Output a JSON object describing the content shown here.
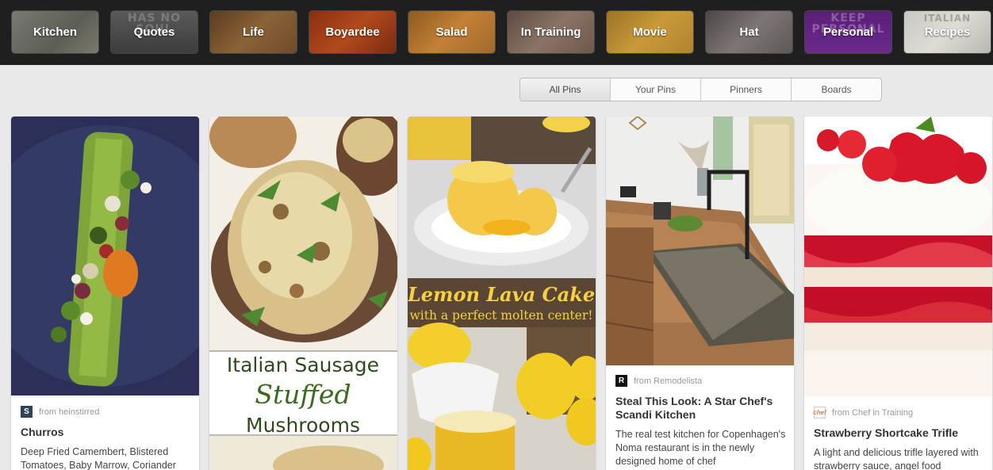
{
  "boards": [
    {
      "label": "Kitchen",
      "bg": "Kitchen"
    },
    {
      "label": "Quotes",
      "bg": "HAS NO SOUL"
    },
    {
      "label": "Life",
      "bg": ""
    },
    {
      "label": "Boyardee",
      "bg": ""
    },
    {
      "label": "Salad",
      "bg": ""
    },
    {
      "label": "In Training",
      "bg": ""
    },
    {
      "label": "Movie",
      "bg": ""
    },
    {
      "label": "Hat",
      "bg": ""
    },
    {
      "label": "Personal",
      "bg": "KEEP PERSONAL"
    },
    {
      "label": "Recipes",
      "bg": "ITALIAN"
    }
  ],
  "tabs": [
    {
      "label": "All Pins",
      "active": true
    },
    {
      "label": "Your Pins",
      "active": false
    },
    {
      "label": "Pinners",
      "active": false
    },
    {
      "label": "Boards",
      "active": false
    }
  ],
  "pins": [
    {
      "source": "from heinstirred",
      "source_icon": "S",
      "title": "Churros",
      "desc": "Deep Fried Camembert, Blistered Tomatoes, Baby Marrow, Coriander"
    },
    {
      "overlay_line1": "Italian Sausage",
      "overlay_line2": "Stuffed",
      "overlay_line3": "Mushrooms"
    },
    {
      "overlay_line1": "Lemon Lava Cake",
      "overlay_line2": "with a perfect molten center!"
    },
    {
      "source": "from Remodelista",
      "source_icon": "R",
      "title": "Steal This Look: A Star Chef's Scandi Kitchen",
      "desc": "The real test kitchen for Copenhagen's Noma restaurant is in the newly designed home of chef"
    },
    {
      "source": "from Chef in Training",
      "source_icon": "chef",
      "title": "Strawberry Shortcake Trifle",
      "desc": "A light and delicious trifle layered with strawberry sauce, angel food"
    }
  ]
}
